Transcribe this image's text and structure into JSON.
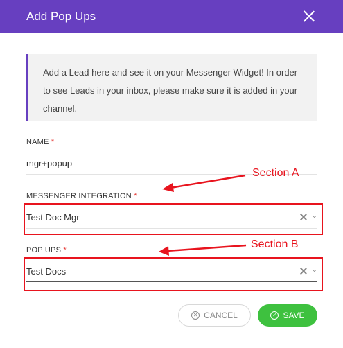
{
  "header": {
    "title": "Add Pop Ups"
  },
  "info": {
    "text": "Add a Lead here and see it on your Messenger Widget! In order to see Leads in your inbox, please make sure it is added in your channel."
  },
  "name_field": {
    "label": "NAME",
    "required": "*",
    "value": "mgr+popup"
  },
  "integration_field": {
    "label": "MESSENGER INTEGRATION",
    "required": "*",
    "value": "Test Doc Mgr"
  },
  "popups_field": {
    "label": "POP UPS",
    "required": "*",
    "value": "Test Docs"
  },
  "annotations": {
    "section_a": "Section A",
    "section_b": "Section B"
  },
  "buttons": {
    "cancel": "CANCEL",
    "save": "SAVE"
  },
  "icons": {
    "close": "close-icon",
    "clear": "clear-icon",
    "chevron": "chevron-down-icon",
    "cancel": "cancel-circle-icon",
    "save": "check-circle-icon"
  },
  "colors": {
    "brand": "#673fc0",
    "save": "#3ec13f",
    "annotation": "#e8141e",
    "required": "#e53935"
  }
}
